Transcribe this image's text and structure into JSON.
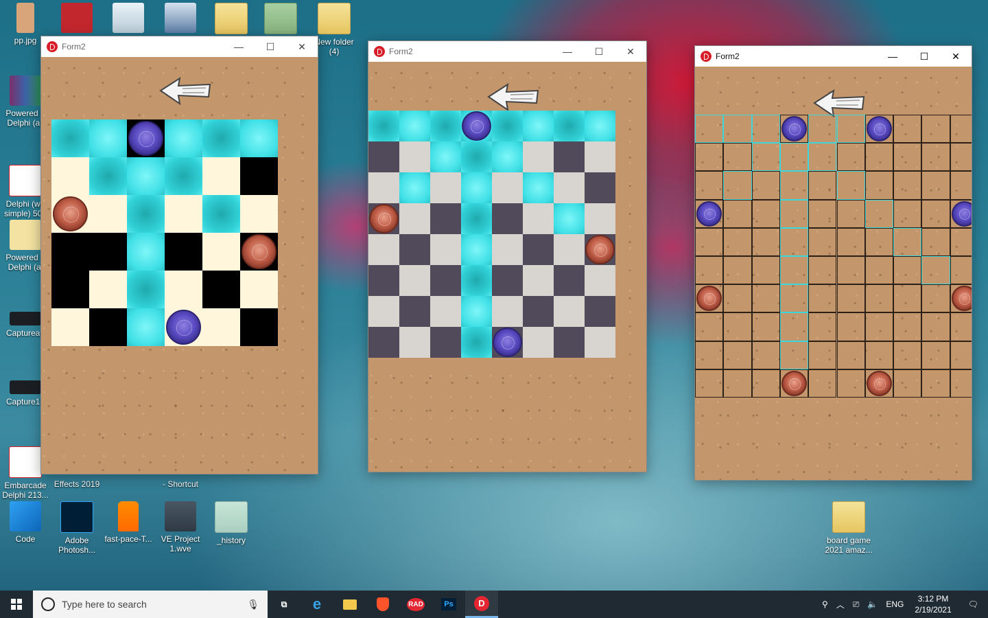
{
  "desktop": {
    "icons": [
      {
        "label": "pp.jpg",
        "icon": "image-file-icon"
      },
      {
        "label": "",
        "icon": "filezilla-icon"
      },
      {
        "label": "",
        "icon": "recycle-bin-icon"
      },
      {
        "label": "",
        "icon": "shortcut-app-icon"
      },
      {
        "label": "",
        "icon": "folder-icon"
      },
      {
        "label": "",
        "icon": "green-folder-icon"
      },
      {
        "label": "New folder\n(4)",
        "icon": "folder-icon"
      },
      {
        "label": "Powered b\nDelphi (all",
        "icon": "winrar-icon"
      },
      {
        "label": "Delphi (wh\nsimple) 500",
        "icon": "delphi-icon"
      },
      {
        "label": "Powered b\nDelphi (al",
        "icon": "delphi-folder-icon"
      },
      {
        "label": "Captureaa",
        "icon": "screenshot-icon"
      },
      {
        "label": "Capture12",
        "icon": "screenshot-icon"
      },
      {
        "label": "Embarcade\nDelphi 213...",
        "icon": "delphi-icon"
      },
      {
        "label": "Effects 2019",
        "icon": "app-icon"
      },
      {
        "label": "- Shortcut",
        "icon": "app-icon"
      },
      {
        "label": "Code",
        "icon": "vscode-icon"
      },
      {
        "label": "Adobe\nPhotosh...",
        "icon": "photoshop-icon"
      },
      {
        "label": "fast-pace-T...",
        "icon": "vlc-icon"
      },
      {
        "label": "VE Project\n1.wve",
        "icon": "video-project-icon"
      },
      {
        "label": "_history",
        "icon": "folder-icon"
      },
      {
        "label": "board game\n2021 amaz...",
        "icon": "folder-icon"
      }
    ]
  },
  "windows": [
    {
      "title": "Form2",
      "board": {
        "rows": 6,
        "cols": 6
      }
    },
    {
      "title": "Form2",
      "board": {
        "rows": 8,
        "cols": 8
      }
    },
    {
      "title": "Form2",
      "board": {
        "rows": 10,
        "cols": 10
      }
    }
  ],
  "window_buttons": {
    "minimize": "—",
    "maximize": "☐",
    "close": "✕"
  },
  "taskbar": {
    "search_placeholder": "Type here to search",
    "apps": [
      "task-view-icon",
      "edge-icon",
      "file-explorer-icon",
      "brave-icon",
      "RAD",
      "Ps",
      "D"
    ],
    "tray": {
      "language": "ENG",
      "time": "3:12 PM",
      "date": "2/19/2021"
    }
  },
  "colors": {
    "window_bg": "#c4966c",
    "cyan": "#36d6dc",
    "cream": "#fff6dc",
    "black": "#000000",
    "light_gray": "#d8d4d0",
    "dark_slate": "#514a5a",
    "grid_line": "#2a2018"
  }
}
